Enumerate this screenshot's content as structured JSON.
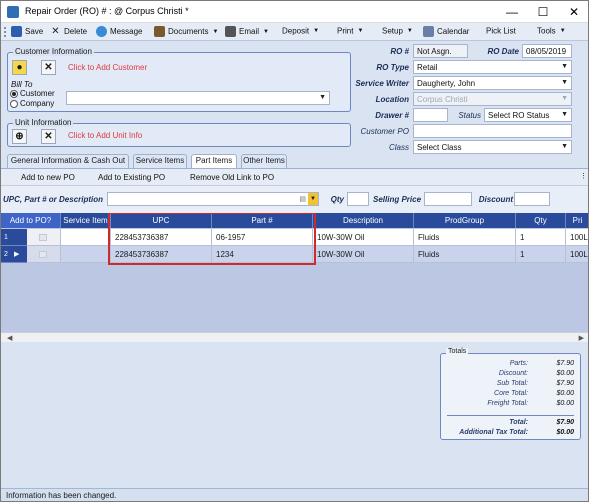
{
  "window": {
    "title": "Repair Order (RO) # : @ Corpus Christi *",
    "minimize_glyph": "—",
    "maximize_glyph": "☐",
    "close_glyph": "✕"
  },
  "toolbar": {
    "save": "Save",
    "delete": "Delete",
    "message": "Message",
    "documents": "Documents",
    "email": "Email",
    "deposit": "Deposit",
    "print": "Print",
    "setup": "Setup",
    "calendar": "Calendar",
    "pick_list": "Pick List",
    "tools": "Tools"
  },
  "customer": {
    "group_title": "Customer Information",
    "add_link": "Click to Add Customer",
    "bill_to": "Bill To",
    "option_customer": "Customer",
    "option_company": "Company",
    "selected_option": "Customer"
  },
  "unit": {
    "group_title": "Unit Information",
    "add_link": "Click to Add Unit Info"
  },
  "ro": {
    "ro_label": "RO #",
    "ro_value": "Not Asgn.",
    "date_label": "RO Date",
    "date_value": "08/05/2019",
    "type_label": "RO Type",
    "type_value": "Retail",
    "writer_label": "Service Writer",
    "writer_value": "Daugherty, John",
    "location_label": "Location",
    "location_value": "Corpus Christi",
    "drawer_label": "Drawer #",
    "drawer_value": "",
    "status_label": "Status",
    "status_value": "Select RO Status",
    "customer_po_label": "Customer PO",
    "customer_po_value": "",
    "class_label": "Class",
    "class_value": "Select Class"
  },
  "tabs": [
    {
      "label": "General Information & Cash Out"
    },
    {
      "label": "Service Items"
    },
    {
      "label": "Part Items"
    },
    {
      "label": "Other Items"
    }
  ],
  "active_tab": "Part Items",
  "parts_toolbar": {
    "add_new_po": "Add to new PO",
    "add_existing_po": "Add to Existing PO",
    "remove_link": "Remove Old Link to PO"
  },
  "entry": {
    "upc_label": "UPC, Part # or Description",
    "upc_value": "",
    "qty_label": "Qty",
    "price_label": "Selling Price",
    "discount_label": "Discount"
  },
  "grid": {
    "columns": [
      "Add to PO?",
      "Service Item",
      "UPC",
      "Part #",
      "Description",
      "ProdGroup",
      "Qty",
      "Pri"
    ],
    "rows": [
      {
        "row_no": "1",
        "upc": "228453736387",
        "part": "06-1957",
        "description": "10W-30W Oil",
        "prodgroup": "Fluids",
        "qty": "1",
        "price": "100L"
      },
      {
        "row_no": "2",
        "upc": "228453736387",
        "part": "1234",
        "description": "10W-30W Oil",
        "prodgroup": "Fluids",
        "qty": "1",
        "price": "100L"
      }
    ]
  },
  "totals": {
    "title": "Totals",
    "rows": [
      {
        "label": "Parts:",
        "value": "$7.90"
      },
      {
        "label": "Discount:",
        "value": "$0.00"
      },
      {
        "label": "Sub Total:",
        "value": "$7.90"
      },
      {
        "label": "Core Total:",
        "value": "$0.00"
      },
      {
        "label": "Freight Total:",
        "value": "$0.00"
      }
    ],
    "total_label": "Total:",
    "total_value": "$7.90",
    "addl_tax_label": "Additional Tax Total:",
    "addl_tax_value": "$0.00"
  },
  "status_bar": {
    "message": "Information has been changed."
  },
  "colors": {
    "accent": "#2a4a9c",
    "link_red": "#e0393e",
    "highlight_box": "#cc2b2b"
  }
}
